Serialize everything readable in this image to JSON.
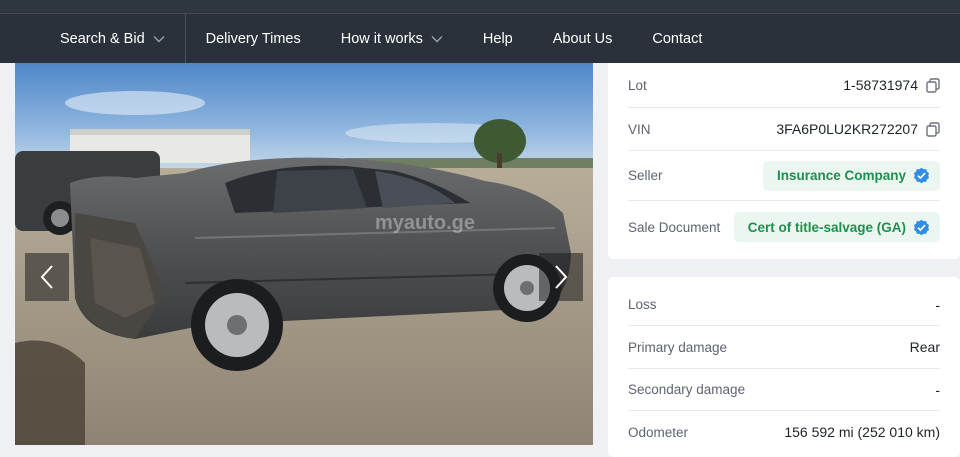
{
  "nav": {
    "items": [
      {
        "label": "Search & Bid",
        "dropdown": true
      },
      {
        "label": "Delivery Times",
        "dropdown": false
      },
      {
        "label": "How it works",
        "dropdown": true
      },
      {
        "label": "Help",
        "dropdown": false
      },
      {
        "label": "About Us",
        "dropdown": false
      },
      {
        "label": "Contact",
        "dropdown": false
      }
    ]
  },
  "photo": {
    "watermark": "myauto.ge",
    "prev_icon": "chevron-left-icon",
    "next_icon": "chevron-right-icon"
  },
  "details": {
    "lot": {
      "label": "Lot",
      "value": "1-58731974"
    },
    "vin": {
      "label": "VIN",
      "value": "3FA6P0LU2KR272207"
    },
    "seller": {
      "label": "Seller",
      "value": "Insurance Company"
    },
    "sale_document": {
      "label": "Sale Document",
      "value": "Cert of title-salvage (GA)"
    }
  },
  "damage": {
    "loss": {
      "label": "Loss",
      "value": "-"
    },
    "primary": {
      "label": "Primary damage",
      "value": "Rear"
    },
    "secondary": {
      "label": "Secondary damage",
      "value": "-"
    },
    "odometer": {
      "label": "Odometer",
      "value": "156 592 mi (252 010 km)"
    }
  },
  "colors": {
    "nav_bg": "#2a313b",
    "badge_bg": "#eaf6ef",
    "badge_text": "#1f8f4d",
    "verified_icon": "#2f8de4"
  }
}
